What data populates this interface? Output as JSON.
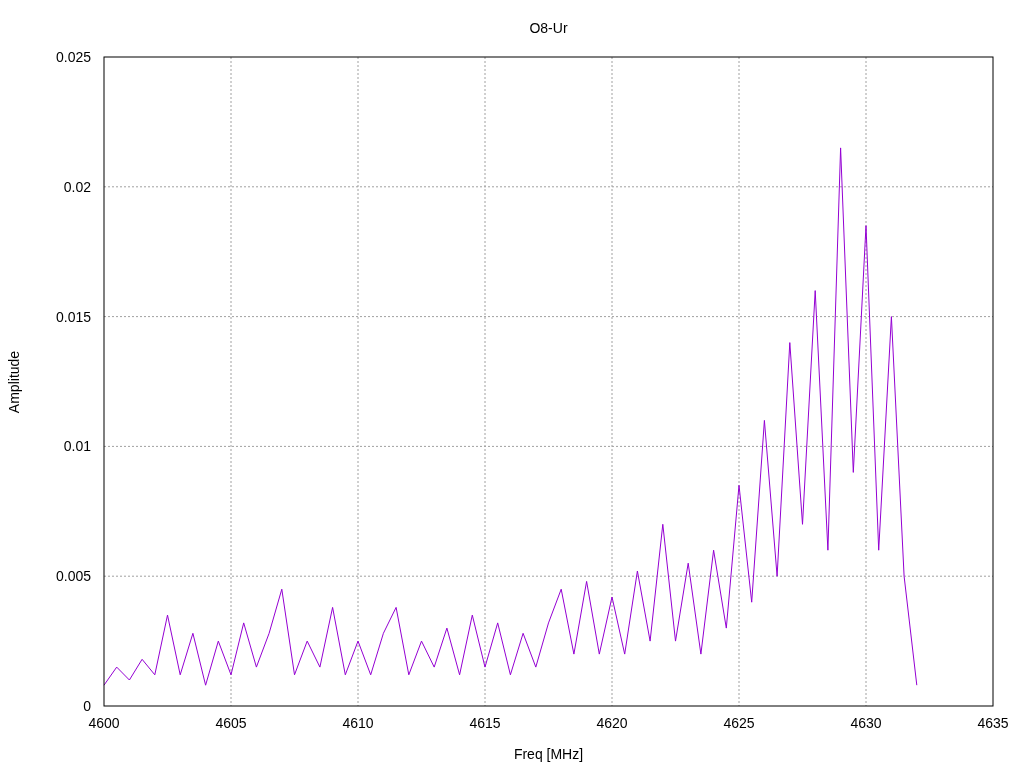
{
  "chart_data": {
    "type": "line",
    "grid": true,
    "title": "O8-Ur",
    "xlabel": "Freq [MHz]",
    "ylabel": "Amplitude",
    "xlim": [
      4600,
      4635
    ],
    "ylim": [
      0,
      0.025
    ],
    "xticks": [
      4600,
      4605,
      4610,
      4615,
      4620,
      4625,
      4630,
      4635
    ],
    "yticks": [
      {
        "value": 0,
        "label": "0"
      },
      {
        "value": 0.005,
        "label": "0.005"
      },
      {
        "value": 0.01,
        "label": "0.01"
      },
      {
        "value": 0.015,
        "label": "0.015"
      },
      {
        "value": 0.02,
        "label": "0.02"
      },
      {
        "value": 0.025,
        "label": "0.025"
      }
    ],
    "x": [
      4600,
      4600.5,
      4601,
      4601.5,
      4602,
      4602.5,
      4603,
      4603.5,
      4604,
      4604.5,
      4605,
      4605.5,
      4606,
      4606.5,
      4607,
      4607.5,
      4608,
      4608.5,
      4609,
      4609.5,
      4610,
      4610.5,
      4611,
      4611.5,
      4612,
      4612.5,
      4613,
      4613.5,
      4614,
      4614.5,
      4615,
      4615.5,
      4616,
      4616.5,
      4617,
      4617.5,
      4618,
      4618.5,
      4619,
      4619.5,
      4620,
      4620.5,
      4621,
      4621.5,
      4622,
      4622.5,
      4623,
      4623.5,
      4624,
      4624.5,
      4625,
      4625.5,
      4626,
      4626.5,
      4627,
      4627.5,
      4628,
      4628.5,
      4629,
      4629.5,
      4630,
      4630.5,
      4631,
      4631.5,
      4632
    ],
    "series": [
      {
        "color": "#9400d3",
        "values": [
          0.0008,
          0.0015,
          0.001,
          0.0018,
          0.0012,
          0.0035,
          0.0012,
          0.0028,
          0.0008,
          0.0025,
          0.0012,
          0.0032,
          0.0015,
          0.0028,
          0.0045,
          0.0012,
          0.0025,
          0.0015,
          0.0038,
          0.0012,
          0.0025,
          0.0012,
          0.0028,
          0.0038,
          0.0012,
          0.0025,
          0.0015,
          0.003,
          0.0012,
          0.0035,
          0.0015,
          0.0032,
          0.0012,
          0.0028,
          0.0015,
          0.0032,
          0.0045,
          0.002,
          0.0048,
          0.002,
          0.0042,
          0.002,
          0.0052,
          0.0025,
          0.007,
          0.0025,
          0.0055,
          0.002,
          0.006,
          0.003,
          0.0085,
          0.004,
          0.011,
          0.005,
          0.014,
          0.007,
          0.016,
          0.006,
          0.0215,
          0.009,
          0.0185,
          0.006,
          0.015,
          0.005,
          0.0008
        ]
      }
    ]
  }
}
